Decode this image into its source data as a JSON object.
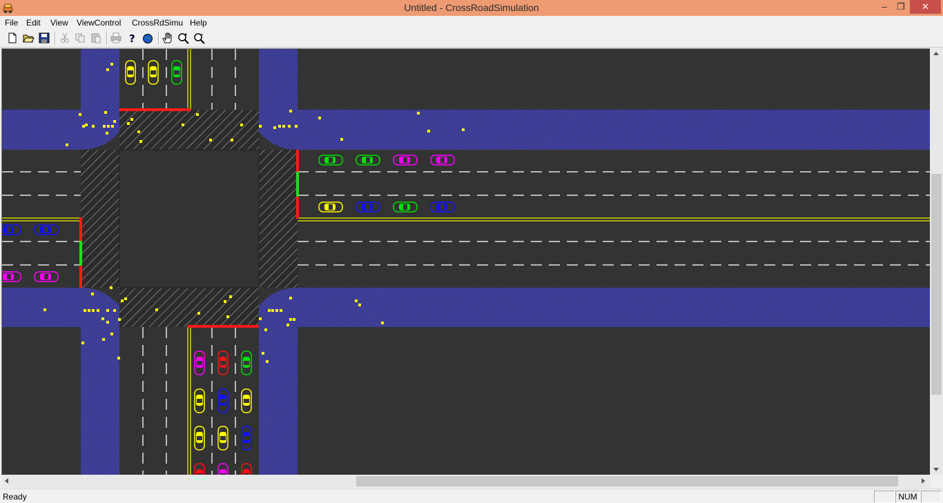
{
  "window": {
    "title": "Untitled - CrossRoadSimulation",
    "minimize_glyph": "–",
    "restore_glyph": "❐",
    "close_glyph": "✕"
  },
  "menu": [
    "File",
    "Edit",
    "View",
    "ViewControl",
    "CrossRdSimu",
    "Help"
  ],
  "toolbar": {
    "buttons": [
      "new-file-icon",
      "open-folder-icon",
      "save-icon",
      "cut-icon",
      "copy-icon",
      "paste-icon",
      "print-icon",
      "help-icon",
      "globe-icon",
      "pan-hand-icon",
      "zoom-in-icon",
      "zoom-out-icon"
    ]
  },
  "status": {
    "text": "Ready",
    "indicator_empty": "",
    "indicator_num": "NUM"
  },
  "colors": {
    "road": "#333333",
    "sidewalk": "#3f3f96",
    "crosswalk": "#2e2e2e",
    "signal_red": "#ff1a1a",
    "signal_green": "#20e020",
    "yellow_line": "#d4d400",
    "pedestrian": "#ffff00",
    "titlebar": "#ee9b73"
  },
  "simulation": {
    "signals": {
      "north_approach": "red",
      "east_approach": [
        "red",
        "green",
        "red"
      ],
      "west_approach": [
        "red",
        "green",
        "red"
      ],
      "south_approach": "red"
    },
    "vehicles_north_lanes": [
      "yellow",
      "yellow",
      "green"
    ],
    "vehicles_east_row1": [
      "green",
      "green",
      "magenta",
      "magenta"
    ],
    "vehicles_east_row2": [
      "yellow",
      "blue",
      "green",
      "blue"
    ],
    "vehicles_west_row1": [
      "blue",
      "blue"
    ],
    "vehicles_west_row2": [
      "magenta",
      "magenta"
    ],
    "vehicles_south_row1": [
      "magenta",
      "red",
      "green"
    ],
    "vehicles_south_row2": [
      "yellow",
      "blue",
      "yellow"
    ],
    "vehicles_south_row3": [
      "yellow",
      "yellow",
      "blue"
    ],
    "vehicles_south_row4": [
      "red",
      "magenta",
      "red"
    ],
    "pedestrian_count": 74
  },
  "scroll": {
    "horizontal_position": 0.58,
    "vertical_position": 0.4
  }
}
